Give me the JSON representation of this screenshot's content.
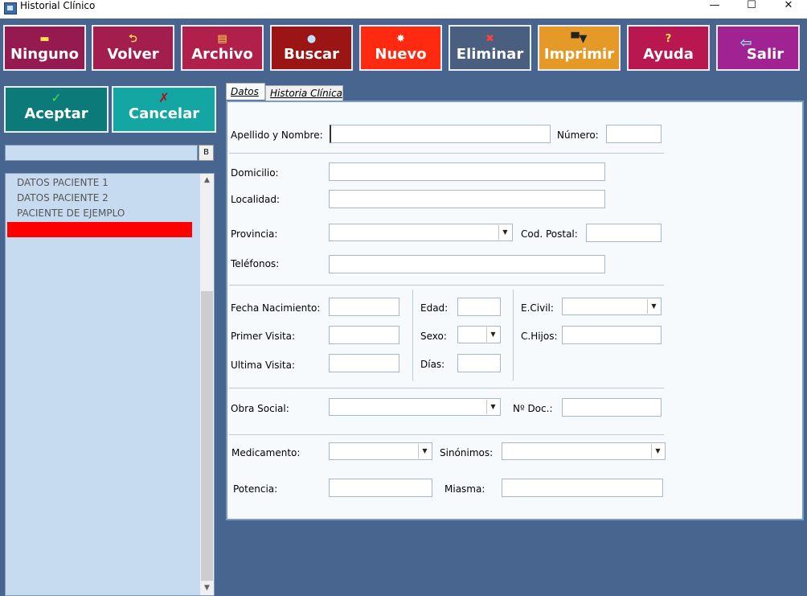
{
  "window": {
    "title": "Historial Clínico",
    "controls": {
      "minimize": "—",
      "maximize": "☐",
      "close": "✕"
    }
  },
  "toolbar": {
    "buttons": [
      {
        "label": "Ninguno",
        "icon": "folder-icon",
        "color": "#951a4f"
      },
      {
        "label": "Volver",
        "icon": "back-arrow-icon",
        "color": "#a31e4c"
      },
      {
        "label": "Archivo",
        "icon": "file-cabinet-icon",
        "color": "#b0204b"
      },
      {
        "label": "Buscar",
        "icon": "magnifier-icon",
        "color": "#9a1513"
      },
      {
        "label": "Nuevo",
        "icon": "new-document-icon",
        "color": "#ff2a10"
      },
      {
        "label": "Eliminar",
        "icon": "delete-folder-icon",
        "color": "#4a5f7f"
      },
      {
        "label": "Imprimir",
        "icon": "printer-icon",
        "color": "#e59a28"
      },
      {
        "label": "Ayuda",
        "icon": "question-icon",
        "color": "#b8174f"
      },
      {
        "label": "Salir",
        "icon": "exit-door-icon",
        "color": "#a12292"
      }
    ]
  },
  "actions": {
    "accept_label": "Aceptar",
    "accept_icon": "checkmark-icon",
    "cancel_label": "Cancelar",
    "cancel_icon": "cross-icon",
    "accept_color": "#0b7a78",
    "cancel_color": "#13a6a2"
  },
  "search": {
    "value": "",
    "button_label": "B"
  },
  "patients": {
    "items": [
      "DATOS PACIENTE 1",
      "DATOS PACIENTE 2",
      "PACIENTE DE EJEMPLO"
    ],
    "selected_color": "#ff0000"
  },
  "tabs": [
    {
      "label": "Datos",
      "active": true
    },
    {
      "label": "Historia Clínica",
      "active": false
    }
  ],
  "form": {
    "apellido_nombre": {
      "label": "Apellido y Nombre:",
      "value": ""
    },
    "numero": {
      "label": "Número:",
      "value": ""
    },
    "domicilio": {
      "label": "Domicilio:",
      "value": ""
    },
    "localidad": {
      "label": "Localidad:",
      "value": ""
    },
    "provincia": {
      "label": "Provincia:",
      "value": ""
    },
    "cod_postal": {
      "label": "Cod. Postal:",
      "value": ""
    },
    "telefonos": {
      "label": "Teléfonos:",
      "value": ""
    },
    "fecha_nacimiento": {
      "label": "Fecha Nacimiento:",
      "value": ""
    },
    "edad": {
      "label": "Edad:",
      "value": ""
    },
    "ecivil": {
      "label": "E.Civil:",
      "value": ""
    },
    "primer_visita": {
      "label": "Primer Visita:",
      "value": ""
    },
    "sexo": {
      "label": "Sexo:",
      "value": ""
    },
    "chijos": {
      "label": "C.Hijos:",
      "value": ""
    },
    "ultima_visita": {
      "label": "Ultima Visita:",
      "value": ""
    },
    "dias": {
      "label": "Días:",
      "value": ""
    },
    "obra_social": {
      "label": "Obra Social:",
      "value": ""
    },
    "nro_doc": {
      "label": "Nº Doc.:",
      "value": ""
    },
    "medicamento": {
      "label": "Medicamento:",
      "value": ""
    },
    "sinonimos": {
      "label": "Sinónimos:",
      "value": ""
    },
    "potencia": {
      "label": "Potencia:",
      "value": ""
    },
    "miasma": {
      "label": "Miasma:",
      "value": ""
    }
  }
}
